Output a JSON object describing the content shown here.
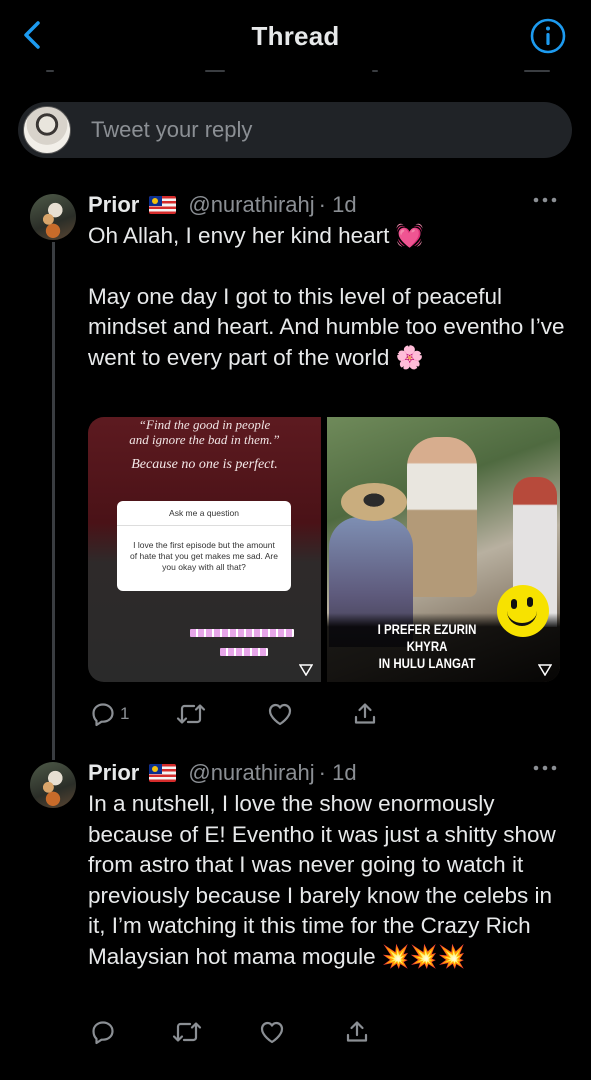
{
  "nav": {
    "title": "Thread",
    "back_icon": "chevron-left-icon",
    "info_icon": "info-icon",
    "accent": "#1d9bf0"
  },
  "reply": {
    "placeholder": "Tweet your reply"
  },
  "tweets": [
    {
      "name": "Prior",
      "flag": "🇲🇾",
      "handle": "@nurathirahj",
      "time": "· 1d",
      "text": [
        "Oh Allah, I envy her kind heart 💓",
        "May one day I got to this level of peaceful mindset and heart. And humble too eventho I’ve went to every part of the world 🌸"
      ],
      "media": {
        "image1": {
          "quote_line1": "“Find the good in people",
          "quote_line2": "and ignore the bad in them.”",
          "quote_line3": "Because no one is perfect.",
          "card_header": "Ask me a question",
          "card_body": "I love the first episode but the amount of hate that you get makes me sad. Are you okay with all that?"
        },
        "image2": {
          "caption_line1": "I PREFER EZURIN KHYRA",
          "caption_line2": "IN HULU LANGAT"
        }
      },
      "actions": {
        "reply_count": "1"
      }
    },
    {
      "name": "Prior",
      "flag": "🇲🇾",
      "handle": "@nurathirahj",
      "time": "· 1d",
      "text": [
        "In a nutshell, I love the show enormously because of E! Eventho it was just a shitty show from astro that I was never going to watch it previously because I barely know the celebs in it, I’m watching it this time for the Crazy Rich Malaysian hot mama mogule 💥💥💥"
      ],
      "actions": {
        "reply_count": ""
      }
    }
  ]
}
